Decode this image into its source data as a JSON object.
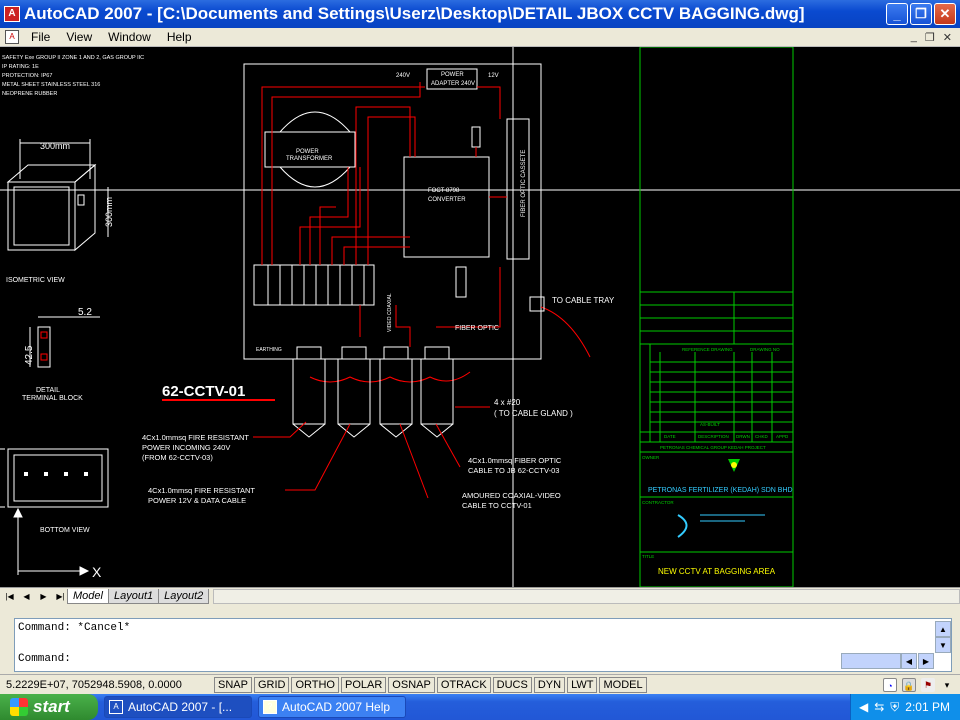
{
  "window": {
    "title": "AutoCAD 2007 - [C:\\Documents and Settings\\Userz\\Desktop\\DETAIL JBOX CCTV BAGGING.dwg]",
    "minimize": "_",
    "restore": "❐",
    "close": "✕"
  },
  "menu": {
    "items": [
      "File",
      "View",
      "Window",
      "Help"
    ]
  },
  "drawing": {
    "notes": [
      "SAFETY Exe GROUP II ZONE 1 AND 2, GAS GROUP IIC",
      "IP RATING: 1E",
      "PROTECTION: IP67",
      "METAL SHEET STAINLESS STEEL 316",
      "NEOPRENE RUBBER"
    ],
    "iso_dim_top": "300mm",
    "iso_dim_side": "300mm",
    "iso_label": "ISOMETRIC VIEW",
    "terminal_dim_w": "5.2",
    "terminal_dim_h": "42.5",
    "terminal_label_1": "DETAIL",
    "terminal_label_2": "TERMINAL BLOCK",
    "bottom_label": "BOTTOM VIEW",
    "tag": "62-CCTV-01",
    "v240": "240V",
    "v12": "12V",
    "power_adapter_1": "POWER",
    "power_adapter_2": "ADAPTER 240V",
    "transformer_1": "POWER",
    "transformer_2": "TRANSFORMER",
    "converter_1": "FOCT-8798",
    "converter_2": "CONVERTER",
    "fiber_cassete": "FIBER OPTIC CASSETE",
    "to_cable_tray": "TO CABLE TRAY",
    "fiber_optic": "FIBER OPTIC",
    "earthing": "EARTHING",
    "video_coaxial": "VIDEO COAXIAL",
    "gland_1": "4 x #20",
    "gland_2": "( TO CABLE GLAND )",
    "cable_a_1": "4Cx1.0mmsq FIRE RESISTANT",
    "cable_a_2": "POWER INCOMING 240V",
    "cable_a_3": "(FROM 62-CCTV-03)",
    "cable_b_1": "4Cx1.0mmsq FIRE RESISTANT",
    "cable_b_2": "POWER 12V & DATA CABLE",
    "cable_c_1": "4Cx1.0mmsq FIBER OPTIC",
    "cable_c_2": "CABLE  TO JB 62-CCTV-03",
    "cable_d_1": "AMOURED COAXIAL-VIDEO",
    "cable_d_2": "CABLE TO CCTV-01",
    "tb_ref": "REFERENCE DRAWING",
    "tb_drawing_no": "DRAWING NO",
    "tb_asbuilt": "AS-BUILT",
    "tb_date": "DATE",
    "tb_description": "DESCRIPTION",
    "tb_drwn": "DRWN",
    "tb_chkd": "CHKD",
    "tb_appd": "APPD",
    "tb_owner_label": "OWNER",
    "tb_owner": "PETRONAS CHEMICAL GROUP KEDAH PROJECT",
    "tb_company": "PETRONAS FERTILIZER (KEDAH) SDN BHD",
    "tb_contractor_label": "CONTRACTOR",
    "tb_title_label": "TITLE",
    "tb_title": "NEW CCTV AT BAGGING AREA",
    "axis_x": "X",
    "axis_y": "Y"
  },
  "tabs": {
    "model": "Model",
    "layout1": "Layout1",
    "layout2": "Layout2"
  },
  "command": {
    "history": "Command: *Cancel*",
    "prompt": "Command:"
  },
  "status": {
    "coords": "5.2229E+07, 7052948.5908, 0.0000",
    "buttons": [
      "SNAP",
      "GRID",
      "ORTHO",
      "POLAR",
      "OSNAP",
      "OTRACK",
      "DUCS",
      "DYN",
      "LWT",
      "MODEL"
    ]
  },
  "taskbar": {
    "start": "start",
    "task1": "AutoCAD 2007 - [...",
    "task2": "AutoCAD 2007 Help",
    "clock": "2:01 PM"
  },
  "colors": {
    "line": "#ffffff",
    "red": "#ff0000",
    "green": "#00cc00",
    "yellow": "#ffff00",
    "cyan": "#00ffff"
  }
}
